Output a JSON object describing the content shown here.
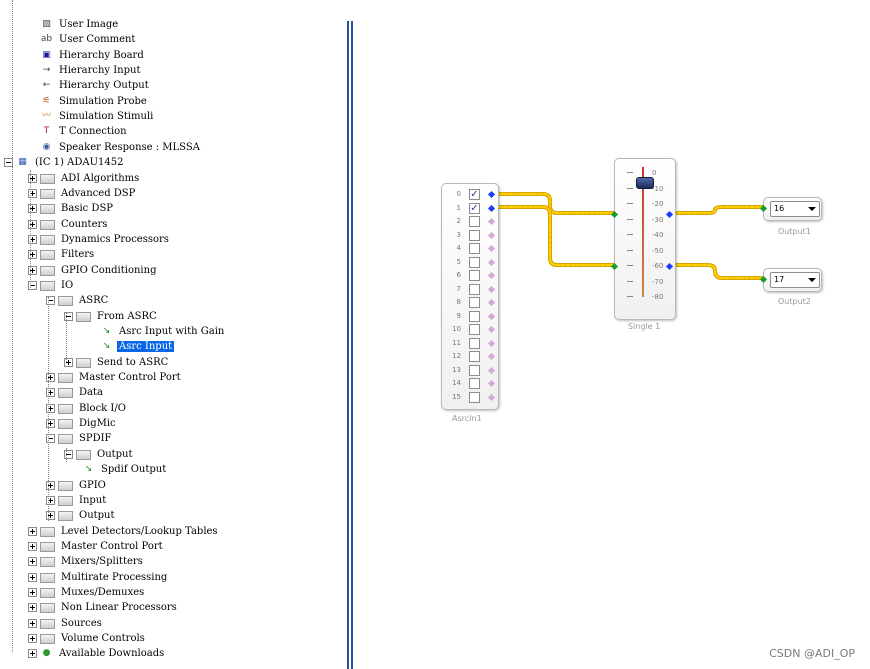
{
  "tree": {
    "items": [
      {
        "label": "User Image",
        "icon": "user-image-icon"
      },
      {
        "label": "User Comment",
        "icon": "user-comment-icon"
      },
      {
        "label": "Hierarchy Board",
        "icon": "hierarchy-board-icon"
      },
      {
        "label": "Hierarchy Input",
        "icon": "hierarchy-input-icon"
      },
      {
        "label": "Hierarchy Output",
        "icon": "hierarchy-output-icon"
      },
      {
        "label": "Simulation Probe",
        "icon": "simulation-probe-icon"
      },
      {
        "label": "Simulation Stimuli",
        "icon": "simulation-stimuli-icon"
      },
      {
        "label": "T Connection",
        "icon": "t-connection-icon"
      },
      {
        "label": "Speaker Response : MLSSA",
        "icon": "speaker-icon"
      },
      {
        "label": "(IC 1) ADAU1452",
        "icon": "ic-chip-icon"
      },
      {
        "label": "ADI Algorithms"
      },
      {
        "label": "Advanced DSP"
      },
      {
        "label": "Basic DSP"
      },
      {
        "label": "Counters"
      },
      {
        "label": "Dynamics Processors"
      },
      {
        "label": "Filters"
      },
      {
        "label": "GPIO Conditioning"
      },
      {
        "label": "IO"
      },
      {
        "label": "ASRC"
      },
      {
        "label": "From ASRC"
      },
      {
        "label": "Asrc Input with Gain",
        "icon": "asrc-block-icon"
      },
      {
        "label": "Asrc Input",
        "icon": "asrc-block-icon"
      },
      {
        "label": "Send to ASRC"
      },
      {
        "label": "Master Control Port"
      },
      {
        "label": "Data"
      },
      {
        "label": "Block I/O"
      },
      {
        "label": "DigMic"
      },
      {
        "label": "SPDIF"
      },
      {
        "label": "Output"
      },
      {
        "label": "Spdif Output",
        "icon": "spdif-block-icon"
      },
      {
        "label": "GPIO"
      },
      {
        "label": "Input"
      },
      {
        "label": "Output"
      },
      {
        "label": "Level Detectors/Lookup Tables"
      },
      {
        "label": "Master Control Port"
      },
      {
        "label": "Mixers/Splitters"
      },
      {
        "label": "Multirate Processing"
      },
      {
        "label": "Muxes/Demuxes"
      },
      {
        "label": "Non Linear Processors"
      },
      {
        "label": "Sources"
      },
      {
        "label": "Volume Controls"
      },
      {
        "label": "Available Downloads",
        "icon": "download-globe-icon"
      }
    ]
  },
  "canvas": {
    "asrc_block": {
      "name": "AsrcIn1",
      "channels": [
        "0",
        "1",
        "2",
        "3",
        "4",
        "5",
        "6",
        "7",
        "8",
        "9",
        "10",
        "11",
        "12",
        "13",
        "14",
        "15"
      ],
      "checked": [
        true,
        true,
        false,
        false,
        false,
        false,
        false,
        false,
        false,
        false,
        false,
        false,
        false,
        false,
        false,
        false
      ]
    },
    "volume_block": {
      "name": "Single 1",
      "ticks": [
        "0",
        "-10",
        "-20",
        "-30",
        "-40",
        "-50",
        "-60",
        "-70",
        "-80"
      ],
      "level_db": -5
    },
    "outputs": [
      {
        "name": "Output1",
        "value": "16"
      },
      {
        "name": "Output2",
        "value": "17"
      }
    ],
    "colors": {
      "wire": "#f2c200",
      "pin_in": "#1a9a2a",
      "pin_out": "#1a3cff",
      "pin_unused": "#d4a7d8",
      "selection": "#0a66e8"
    }
  },
  "watermark": "CSDN @ADI_OP"
}
